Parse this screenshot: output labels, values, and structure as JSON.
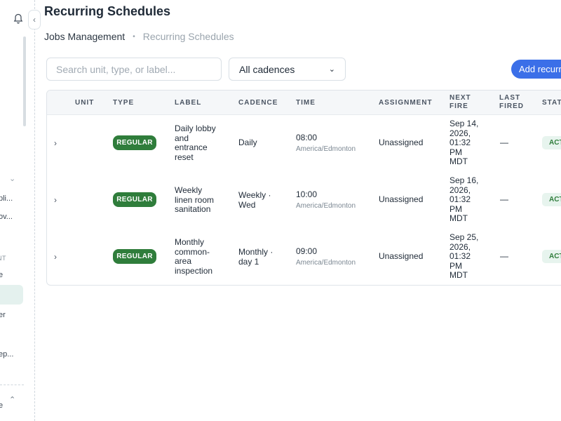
{
  "app": {
    "page_title": "Recurring Schedules",
    "breadcrumb": {
      "first": "Jobs Management",
      "separator": "•",
      "current": "Recurring Schedules"
    }
  },
  "sidebar": {
    "truncated_items": [
      "pli...",
      "ov...",
      "NT",
      "e",
      "er",
      "ep...",
      "e"
    ],
    "collapse_icon": "chevron-left-icon",
    "bell_icon": "bell-icon"
  },
  "toolbar": {
    "search_placeholder": "Search unit, type, or label...",
    "cadence_filter": "All cadences",
    "add_button": "Add recurring"
  },
  "table": {
    "headers": {
      "unit": "UNIT",
      "type": "TYPE",
      "label": "LABEL",
      "cadence": "CADENCE",
      "time": "TIME",
      "assignment": "ASSIGNMENT",
      "next_fire_1": "NEXT",
      "next_fire_2": "FIRE",
      "last_fired_1": "LAST",
      "last_fired_2": "FIRED",
      "status": "STATUS"
    },
    "rows": [
      {
        "expand": "›",
        "type": "REGULAR",
        "label": [
          "Daily lobby",
          "and",
          "entrance",
          "reset"
        ],
        "cadence": [
          "Daily"
        ],
        "time": "08:00",
        "timezone": "America/Edmonton",
        "assignment": "Unassigned",
        "next_fire": [
          "Sep 14,",
          "2026,",
          "01:32",
          "PM",
          "MDT"
        ],
        "last_fired": "—",
        "status": "ACTIVE"
      },
      {
        "expand": "›",
        "type": "REGULAR",
        "label": [
          "Weekly",
          "linen room",
          "sanitation"
        ],
        "cadence": [
          "Weekly ·",
          "Wed"
        ],
        "time": "10:00",
        "timezone": "America/Edmonton",
        "assignment": "Unassigned",
        "next_fire": [
          "Sep 16,",
          "2026,",
          "01:32",
          "PM",
          "MDT"
        ],
        "last_fired": "—",
        "status": "ACTIVE"
      },
      {
        "expand": "›",
        "type": "REGULAR",
        "label": [
          "Monthly",
          "common-",
          "area",
          "inspection"
        ],
        "cadence": [
          "Monthly ·",
          "day 1"
        ],
        "time": "09:00",
        "timezone": "America/Edmonton",
        "assignment": "Unassigned",
        "next_fire": [
          "Sep 25,",
          "2026,",
          "01:32",
          "PM",
          "MDT"
        ],
        "last_fired": "—",
        "status": "ACTIVE"
      }
    ]
  },
  "colors": {
    "primary": "#3b6fe8",
    "badge_green": "#2f7d3b",
    "status_bg": "#e7f4ee"
  }
}
